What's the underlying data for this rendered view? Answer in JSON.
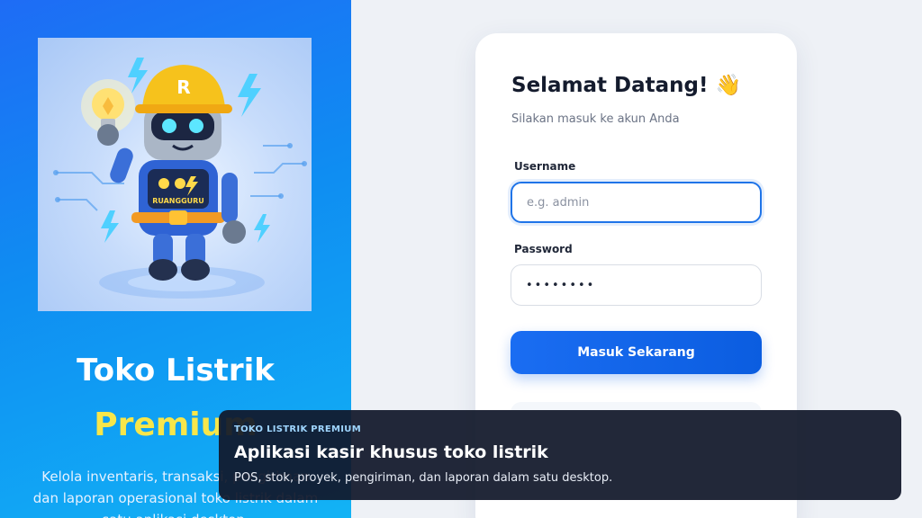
{
  "hero": {
    "title": "Toko Listrik",
    "subtitle": "Premium",
    "description": "Kelola inventaris, transaksi, pengiriman dan laporan operasional toko listrik dalam satu aplikasi desktop.",
    "robot_badge_text": "RUANGGURU",
    "robot_helmet_letter": "R"
  },
  "login": {
    "title": "Selamat Datang!",
    "wave_emoji": "👋",
    "subtitle": "Silakan masuk ke akun Anda",
    "username_label": "Username",
    "username_placeholder": "e.g. admin",
    "password_label": "Password",
    "password_value": "••••••••",
    "submit_label": "Masuk Sekarang"
  },
  "toast": {
    "kicker": "TOKO LISTRIK PREMIUM",
    "title": "Aplikasi kasir khusus toko listrik",
    "description": "POS, stok, proyek, pengiriman, dan laporan dalam satu desktop."
  },
  "colors": {
    "hero_gradient_start": "#1e6cf5",
    "hero_gradient_end": "#12b3f5",
    "accent_yellow": "#f7e64a",
    "primary_button": "#1a6df2",
    "toast_bg": "#11182a"
  }
}
